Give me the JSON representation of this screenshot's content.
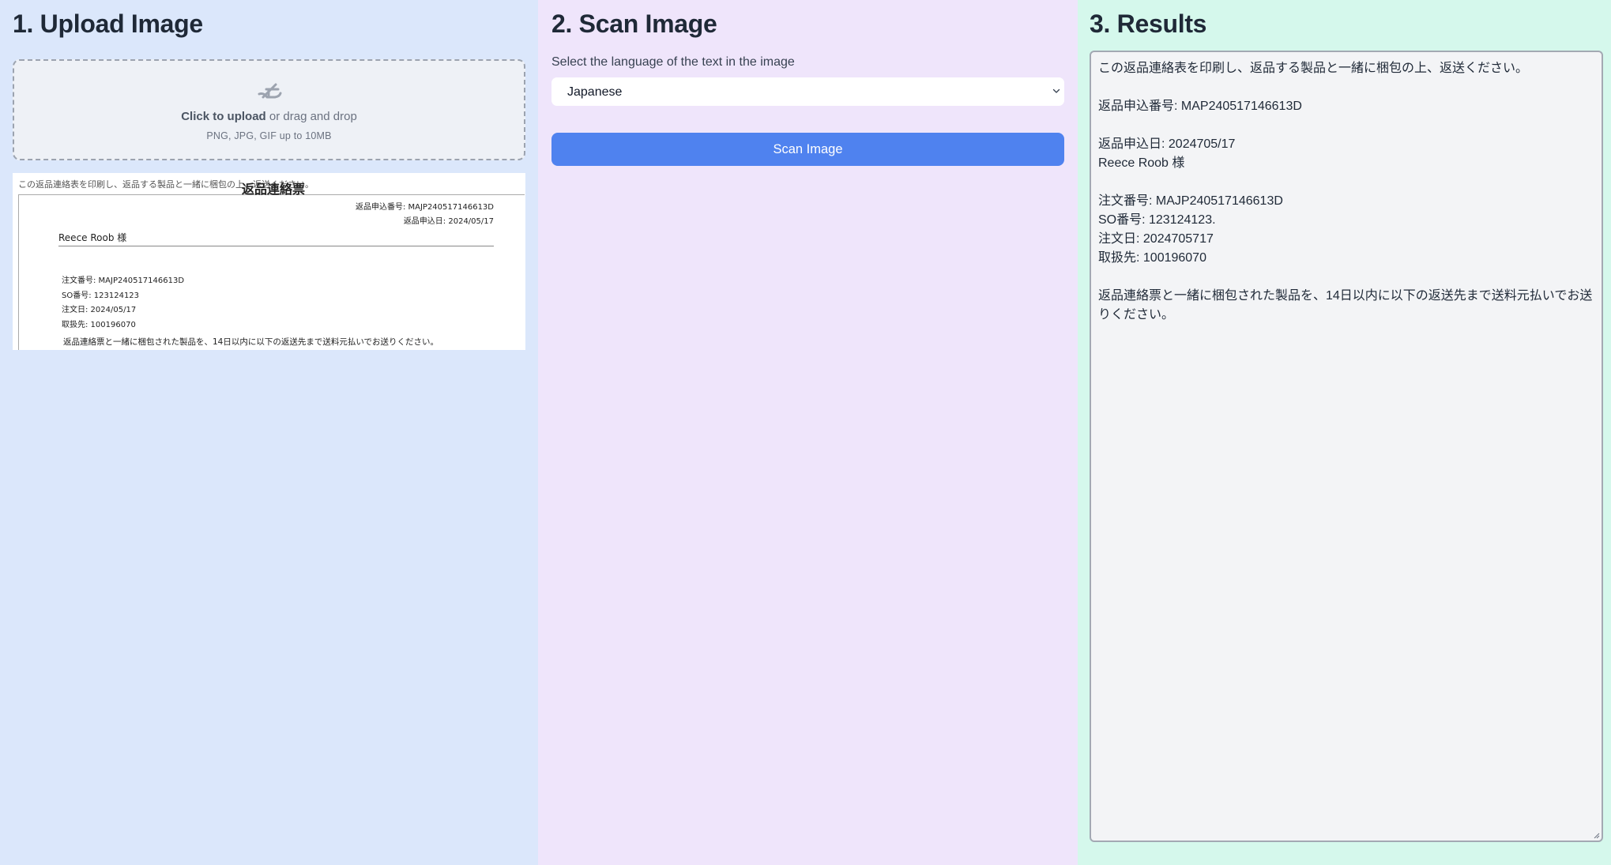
{
  "upload": {
    "heading": "1. Upload Image",
    "dropzone": {
      "click_text": "Click to upload",
      "drag_text": " or drag and drop",
      "hint": "PNG, JPG, GIF up to 10MB",
      "icon": "upload-image-icon"
    },
    "preview": {
      "top_line": "この返品連絡表を印刷し、返品する製品と一緒に梱包の上、返送ください。",
      "title": "返品連絡票",
      "return_no": "返品申込番号: MAJP240517146613D",
      "return_date": "返品申込日: 2024/05/17",
      "customer": "Reece Roob 様",
      "order_no": "注文番号: MAJP240517146613D",
      "so_no": "SO番号: 123124123",
      "order_date": "注文日: 2024/05/17",
      "supplier": "取扱先: 100196070",
      "note": "返品連絡票と一緒に梱包された製品を、14日以内に以下の返送先まで送料元払いでお送りください。"
    }
  },
  "scan": {
    "heading": "2. Scan Image",
    "language_label": "Select the language of the text in the image",
    "language_selected": "Japanese",
    "button_label": "Scan Image",
    "button_color": "#4f82ef"
  },
  "results": {
    "heading": "3. Results",
    "lines": [
      "この返品連絡表を印刷し、返品する製品と一緒に梱包の上、返送ください。",
      "",
      "返品申込番号: MAP240517146613D",
      "",
      "返品申込日: 2024705/17",
      "Reece Roob 様",
      "",
      "注文番号: MAJP240517146613D",
      "SO番号: 123124123.",
      "注文日: 2024705717",
      "取扱先: 100196070",
      "",
      "返品連絡票と一緒に梱包された製品を、14日以内に以下の返送先まで送料元払いでお送",
      "りください。"
    ]
  },
  "colors": {
    "upload_bg": "#dbe7fb",
    "scan_bg": "#efe5fb",
    "results_bg": "#d5f8ec"
  }
}
